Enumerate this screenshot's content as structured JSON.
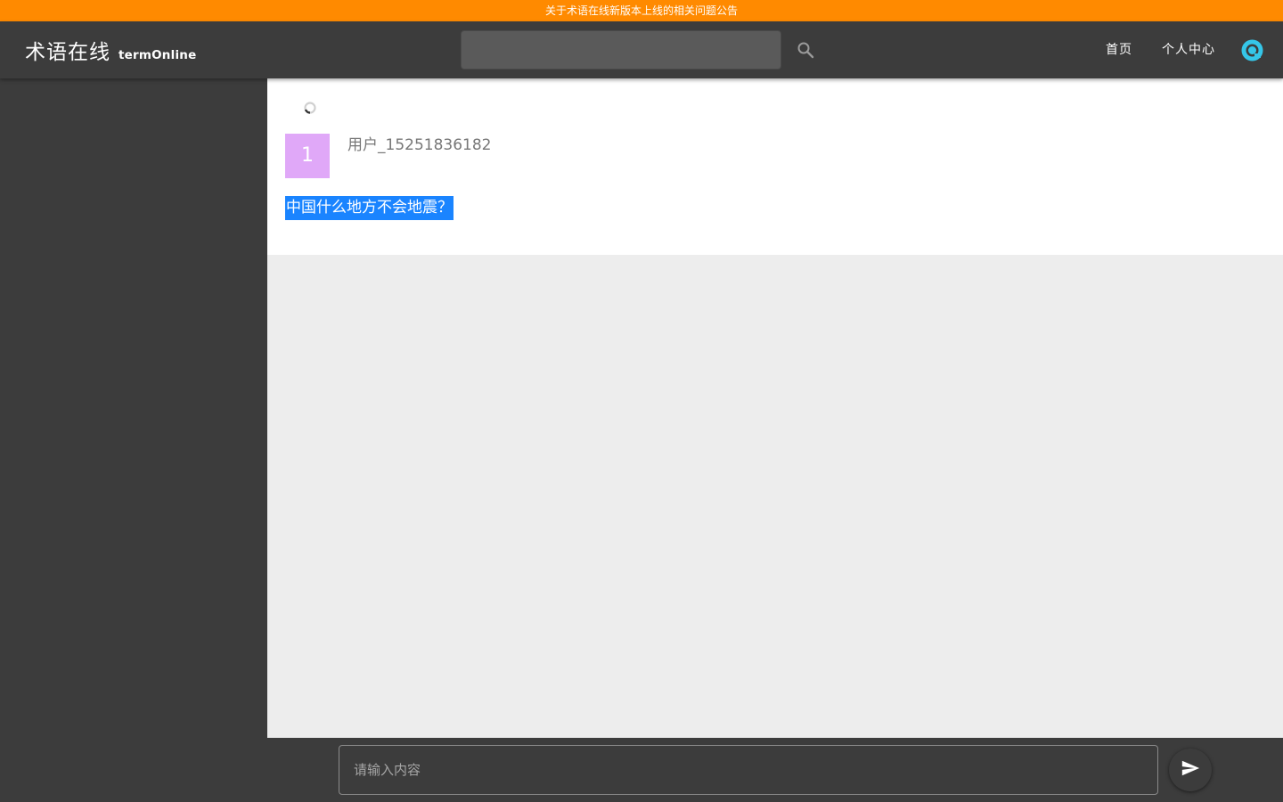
{
  "announcement": {
    "text": "关于术语在线新版本上线的相关问题公告"
  },
  "header": {
    "logo_cn": "术语在线",
    "logo_en": "termOnline",
    "search": {
      "value": "",
      "placeholder": ""
    },
    "nav": {
      "home": "首页",
      "user_center": "个人中心"
    }
  },
  "post": {
    "avatar_text": "1",
    "username": "用户_15251836182",
    "question": "中国什么地方不会地震？"
  },
  "composer": {
    "placeholder": "请输入内容"
  },
  "colors": {
    "announcement_bg": "#ff8a00",
    "header_bg": "#3c3c3c",
    "avatar_bg": "#e0a8f8",
    "selection_bg": "#1a84ff",
    "brand_icon": "#35c6e8"
  },
  "icons": {
    "search": "search-icon",
    "profile": "profile-ring-icon",
    "loading": "loading-spinner-icon",
    "send": "send-icon"
  }
}
